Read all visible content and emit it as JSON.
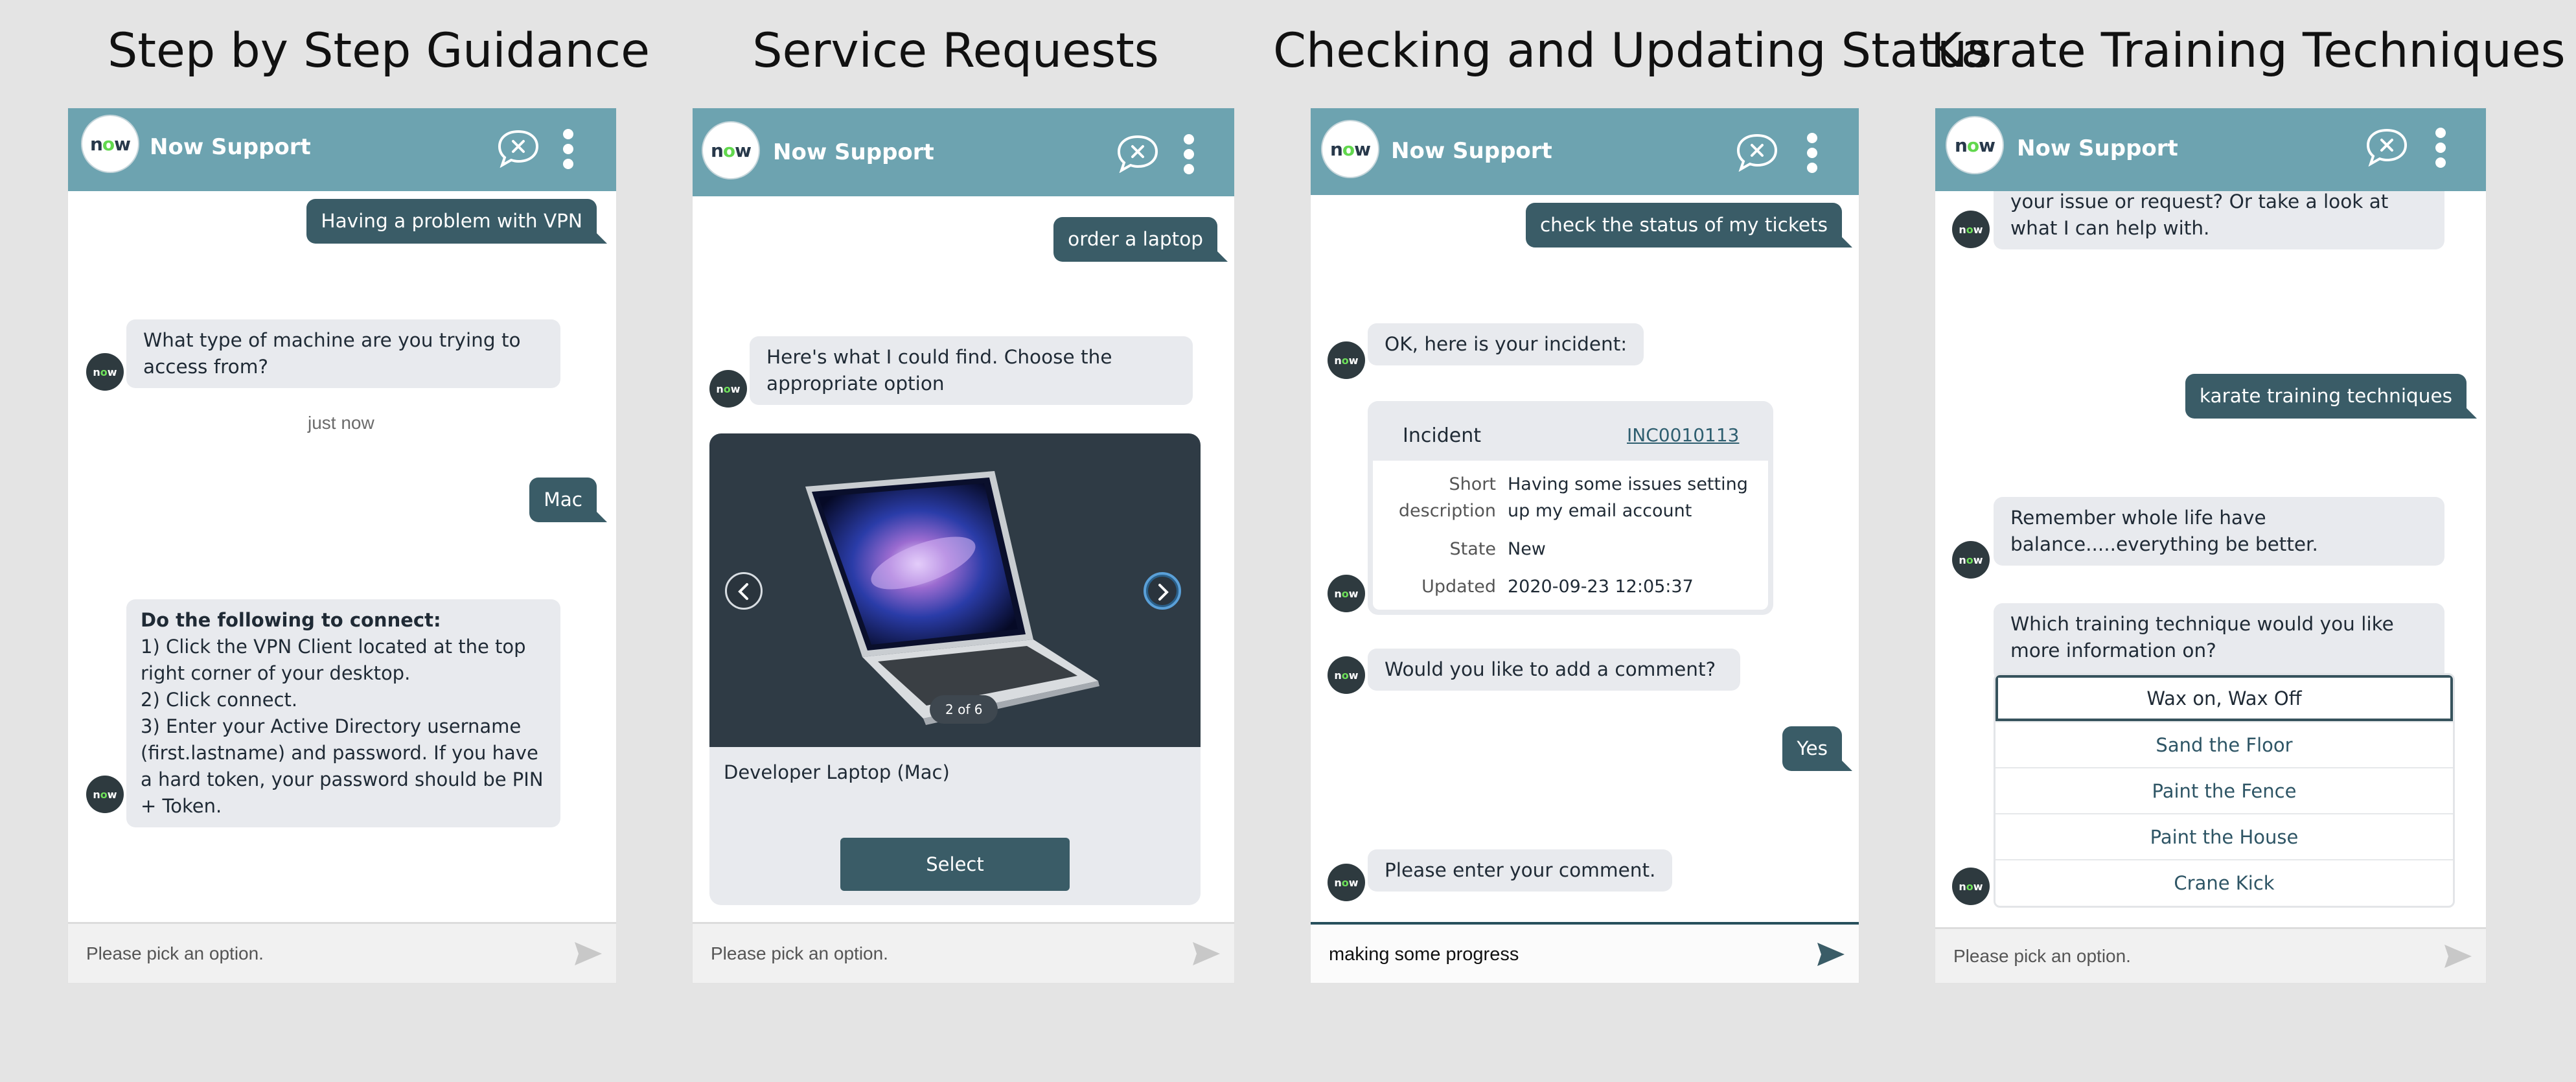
{
  "app": {
    "brand": "Now Support",
    "logo_text": "now",
    "avatar_text": "now",
    "colors": {
      "header": "#6da3b0",
      "user_bubble": "#3a5c67",
      "bot_bubble": "#e8eaee",
      "logo_accent": "#62d84e"
    },
    "icons": [
      "end-chat-icon",
      "more-vertical-icon",
      "send-icon",
      "chevron-left-icon",
      "chevron-right-icon"
    ]
  },
  "panels": [
    {
      "title": "Step by Step Guidance",
      "input_placeholder": "Please pick an option.",
      "messages": {
        "user1": "Having a problem with VPN",
        "bot1": "What type of machine are you trying to access from?",
        "timestamp": "just now",
        "user2": "Mac",
        "bot2_lines": [
          "Do the following to connect:",
          "1) Click the VPN Client located at the top right corner of your desktop.",
          "2) Click connect.",
          "3) Enter your Active Directory username (first.lastname) and password. If you have a hard token, your password should be PIN + Token."
        ]
      }
    },
    {
      "title": "Service Requests",
      "input_placeholder": "Please pick an option.",
      "messages": {
        "user1": "order a laptop",
        "bot1": "Here's what I could find. Choose the appropriate option"
      },
      "carousel": {
        "item_title": "Developer Laptop (Mac)",
        "pager": "2 of 6",
        "select_label": "Select"
      }
    },
    {
      "title": "Checking and Updating Status",
      "input_value": "making some progress",
      "messages": {
        "user1": "check the status of my tickets",
        "bot1": "OK, here is your incident:",
        "bot2": "Would you like to add a comment?",
        "user2": "Yes",
        "bot3": "Please enter your comment."
      },
      "incident": {
        "label": "Incident",
        "number": "INC0010113",
        "short_description_key": "Short description",
        "short_description": "Having some issues setting up my email account",
        "state_key": "State",
        "state": "New",
        "updated_key": "Updated",
        "updated": "2020-09-23 12:05:37"
      }
    },
    {
      "title": "Karate Training Techniques",
      "input_placeholder": "Please pick an option.",
      "messages": {
        "bot0": "your issue or request? Or take a look at what I can help with.",
        "user1": "karate training techniques",
        "bot1": "Remember whole life have balance.....everything be better.",
        "bot2": "Which training technique would you like more information on?"
      },
      "options": [
        "Wax on, Wax Off",
        "Sand the Floor",
        "Paint the Fence",
        "Paint the House",
        "Crane Kick"
      ]
    }
  ]
}
